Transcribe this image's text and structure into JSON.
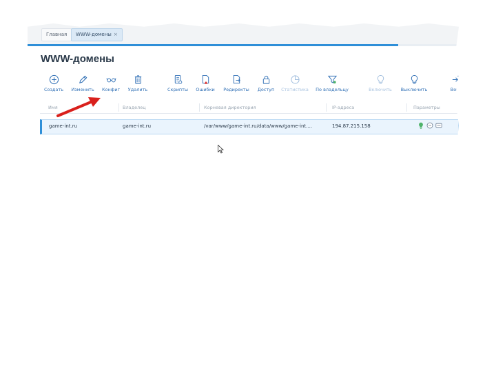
{
  "tabs": {
    "home": "Главная",
    "active": "WWW-домены",
    "close_glyph": "×"
  },
  "page": {
    "title": "WWW-домены"
  },
  "toolbar": [
    {
      "label": "Создать",
      "icon": "plus-circle-icon"
    },
    {
      "label": "Изменить",
      "icon": "pencil-icon"
    },
    {
      "label": "Конфиг",
      "icon": "glasses-icon"
    },
    {
      "label": "Удалить",
      "icon": "trash-icon"
    },
    {
      "label": "Скрипты",
      "icon": "script-file-icon"
    },
    {
      "label": "Ошибки",
      "icon": "error-file-icon"
    },
    {
      "label": "Редиректы",
      "icon": "redirect-file-icon"
    },
    {
      "label": "Доступ",
      "icon": "lock-icon"
    },
    {
      "label": "Статистика",
      "icon": "pie-chart-icon",
      "disabled": true
    },
    {
      "label": "По владельцу",
      "icon": "filter-icon"
    },
    {
      "label": "Включить",
      "icon": "bulb-on-icon",
      "disabled": true
    },
    {
      "label": "Выключить",
      "icon": "bulb-off-icon"
    },
    {
      "label": "Войт",
      "icon": "login-icon"
    }
  ],
  "table": {
    "columns": [
      "Имя",
      "Владелец",
      "Корневая директория",
      "IP-адреса",
      "Параметры"
    ],
    "rows": [
      {
        "name": "game-int.ru",
        "owner": "game-int.ru",
        "root": "/var/www/game-int.ru/data/www/game-int....",
        "ip": "194.87.215.158",
        "params": [
          "bulb-param-icon",
          "cgi-param-icon",
          "ssl-param-icon"
        ]
      }
    ]
  },
  "colors": {
    "accent": "#2f8fd8",
    "toolbar_text": "#2f6fb5",
    "selected_row": "#eaf4fd",
    "annotation_arrow": "#d9201c"
  }
}
